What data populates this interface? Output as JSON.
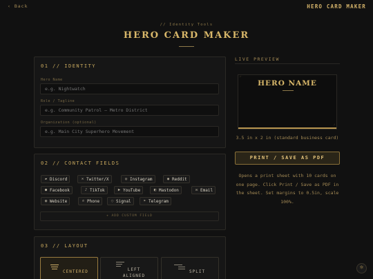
{
  "topbar": {
    "back_label": "‹ Back",
    "app_title": "HERO CARD MAKER"
  },
  "header": {
    "eyebrow": "// Identity Tools",
    "title": "HERO CARD MAKER"
  },
  "identity": {
    "heading": "01 // IDENTITY",
    "fields": [
      {
        "label": "Hero Name",
        "placeholder": "e.g. Nightwatch",
        "value": ""
      },
      {
        "label": "Role / Tagline",
        "placeholder": "e.g. Community Patrol — Metro District",
        "value": ""
      },
      {
        "label": "Organization (optional)",
        "placeholder": "e.g. Main City Superhero Movement",
        "value": ""
      }
    ]
  },
  "contact": {
    "heading": "02 // CONTACT FIELDS",
    "chips": [
      {
        "label": "Discord",
        "icon": "discord-icon",
        "glyph": "▰"
      },
      {
        "label": "Twitter/X",
        "icon": "x-icon",
        "glyph": "✕"
      },
      {
        "label": "Instagram",
        "icon": "instagram-icon",
        "glyph": "◎"
      },
      {
        "label": "Reddit",
        "icon": "reddit-icon",
        "glyph": "◉"
      },
      {
        "label": "Facebook",
        "icon": "facebook-icon",
        "glyph": "●"
      },
      {
        "label": "TikTok",
        "icon": "tiktok-icon",
        "glyph": "♪"
      },
      {
        "label": "YouTube",
        "icon": "youtube-icon",
        "glyph": "▶"
      },
      {
        "label": "Mastodon",
        "icon": "mastodon-icon",
        "glyph": "◧"
      },
      {
        "label": "Email",
        "icon": "email-icon",
        "glyph": "✉"
      },
      {
        "label": "Website",
        "icon": "globe-icon",
        "glyph": "◍"
      },
      {
        "label": "Phone",
        "icon": "phone-icon",
        "glyph": "✆"
      },
      {
        "label": "Signal",
        "icon": "signal-icon",
        "glyph": "◌"
      },
      {
        "label": "Telegram",
        "icon": "telegram-icon",
        "glyph": "➤"
      }
    ],
    "add_custom_label": "+ ADD CUSTOM FIELD"
  },
  "layout": {
    "heading": "03 // LAYOUT",
    "options": [
      {
        "label": "CENTERED",
        "selected": true
      },
      {
        "label": "LEFT ALIGNED",
        "selected": false
      },
      {
        "label": "SPLIT",
        "selected": false
      }
    ]
  },
  "preview": {
    "heading": "LIVE PREVIEW",
    "card_name": "HERO NAME",
    "size_note": "3.5 in x 2 in (standard business card)",
    "print_button": "PRINT / SAVE AS PDF",
    "print_note": "Opens a print sheet with 10 cards on one page. Click Print / Save as PDF in the sheet. Set margins to 0.5in, scale 100%."
  },
  "fab": {
    "icon": "settings-icon",
    "glyph": "☼"
  },
  "colors": {
    "accent": "#d4b36a",
    "background": "#111111",
    "panel": "#161616"
  }
}
